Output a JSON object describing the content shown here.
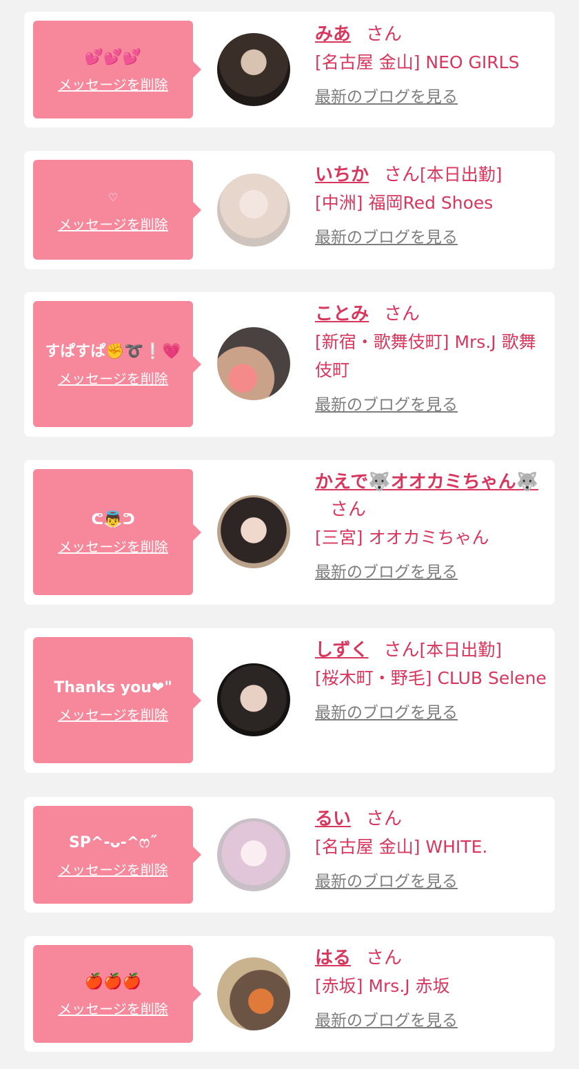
{
  "colors": {
    "accent": "#d9365e",
    "bubble": "#f7889b",
    "muted": "#7d7d7d",
    "background": "#f2f2f2"
  },
  "delete_label": "メッセージを削除",
  "blog_label": "最新のブログを見る",
  "san_label": "さん",
  "cards": [
    {
      "message": "💕💕💕",
      "name": "みあ",
      "status": "",
      "shop": "[名古屋 金山] NEO GIRLS"
    },
    {
      "message": "♡",
      "name": "いちか",
      "status": "[本日出勤]",
      "shop": "[中洲] 福岡Red Shoes"
    },
    {
      "message": "すぱすぱ✊➰❕💗",
      "name": "ことみ",
      "status": "",
      "shop": "[新宿・歌舞伎町] Mrs.J 歌舞伎町"
    },
    {
      "message": "ᕦ👼ᕤ",
      "name": "かえで🐺オオカミちゃん🐺",
      "status": "",
      "shop": "[三宮] オオカミちゃん"
    },
    {
      "message": "Thanks you❤︎\"",
      "name": "しずく",
      "status": "[本日出勤]",
      "shop": "[桜木町・野毛] CLUB Selene"
    },
    {
      "message": "SP^-ᴗ-^ෆ˝",
      "name": "るい",
      "status": "",
      "shop": "[名古屋 金山] WHITE."
    },
    {
      "message": "🍎🍎🍎",
      "name": "はる",
      "status": "",
      "shop": "[赤坂] Mrs.J 赤坂"
    }
  ]
}
